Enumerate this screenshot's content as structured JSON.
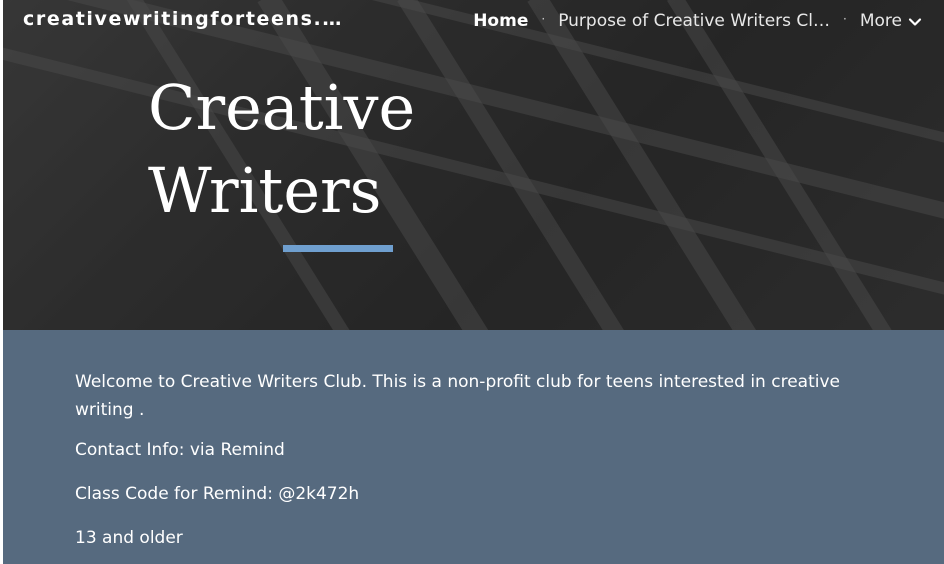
{
  "site": {
    "title": "creativewritingforteens.…"
  },
  "nav": {
    "items": [
      {
        "label": "Home",
        "active": true
      },
      {
        "label": "Purpose of Creative Writers Cl…",
        "active": false
      }
    ],
    "more_label": "More"
  },
  "hero": {
    "title_line1": "Creative",
    "title_line2": "Writers"
  },
  "content": {
    "welcome": "Welcome to Creative Writers Club. This is a non-profit club for teens interested in creative writing .",
    "contact": "Contact Info: via Remind",
    "class_code": "Class Code for Remind: @2k472h",
    "age": "13 and older"
  },
  "colors": {
    "accent": "#6f9fcf",
    "content_bg": "#566a7f"
  }
}
